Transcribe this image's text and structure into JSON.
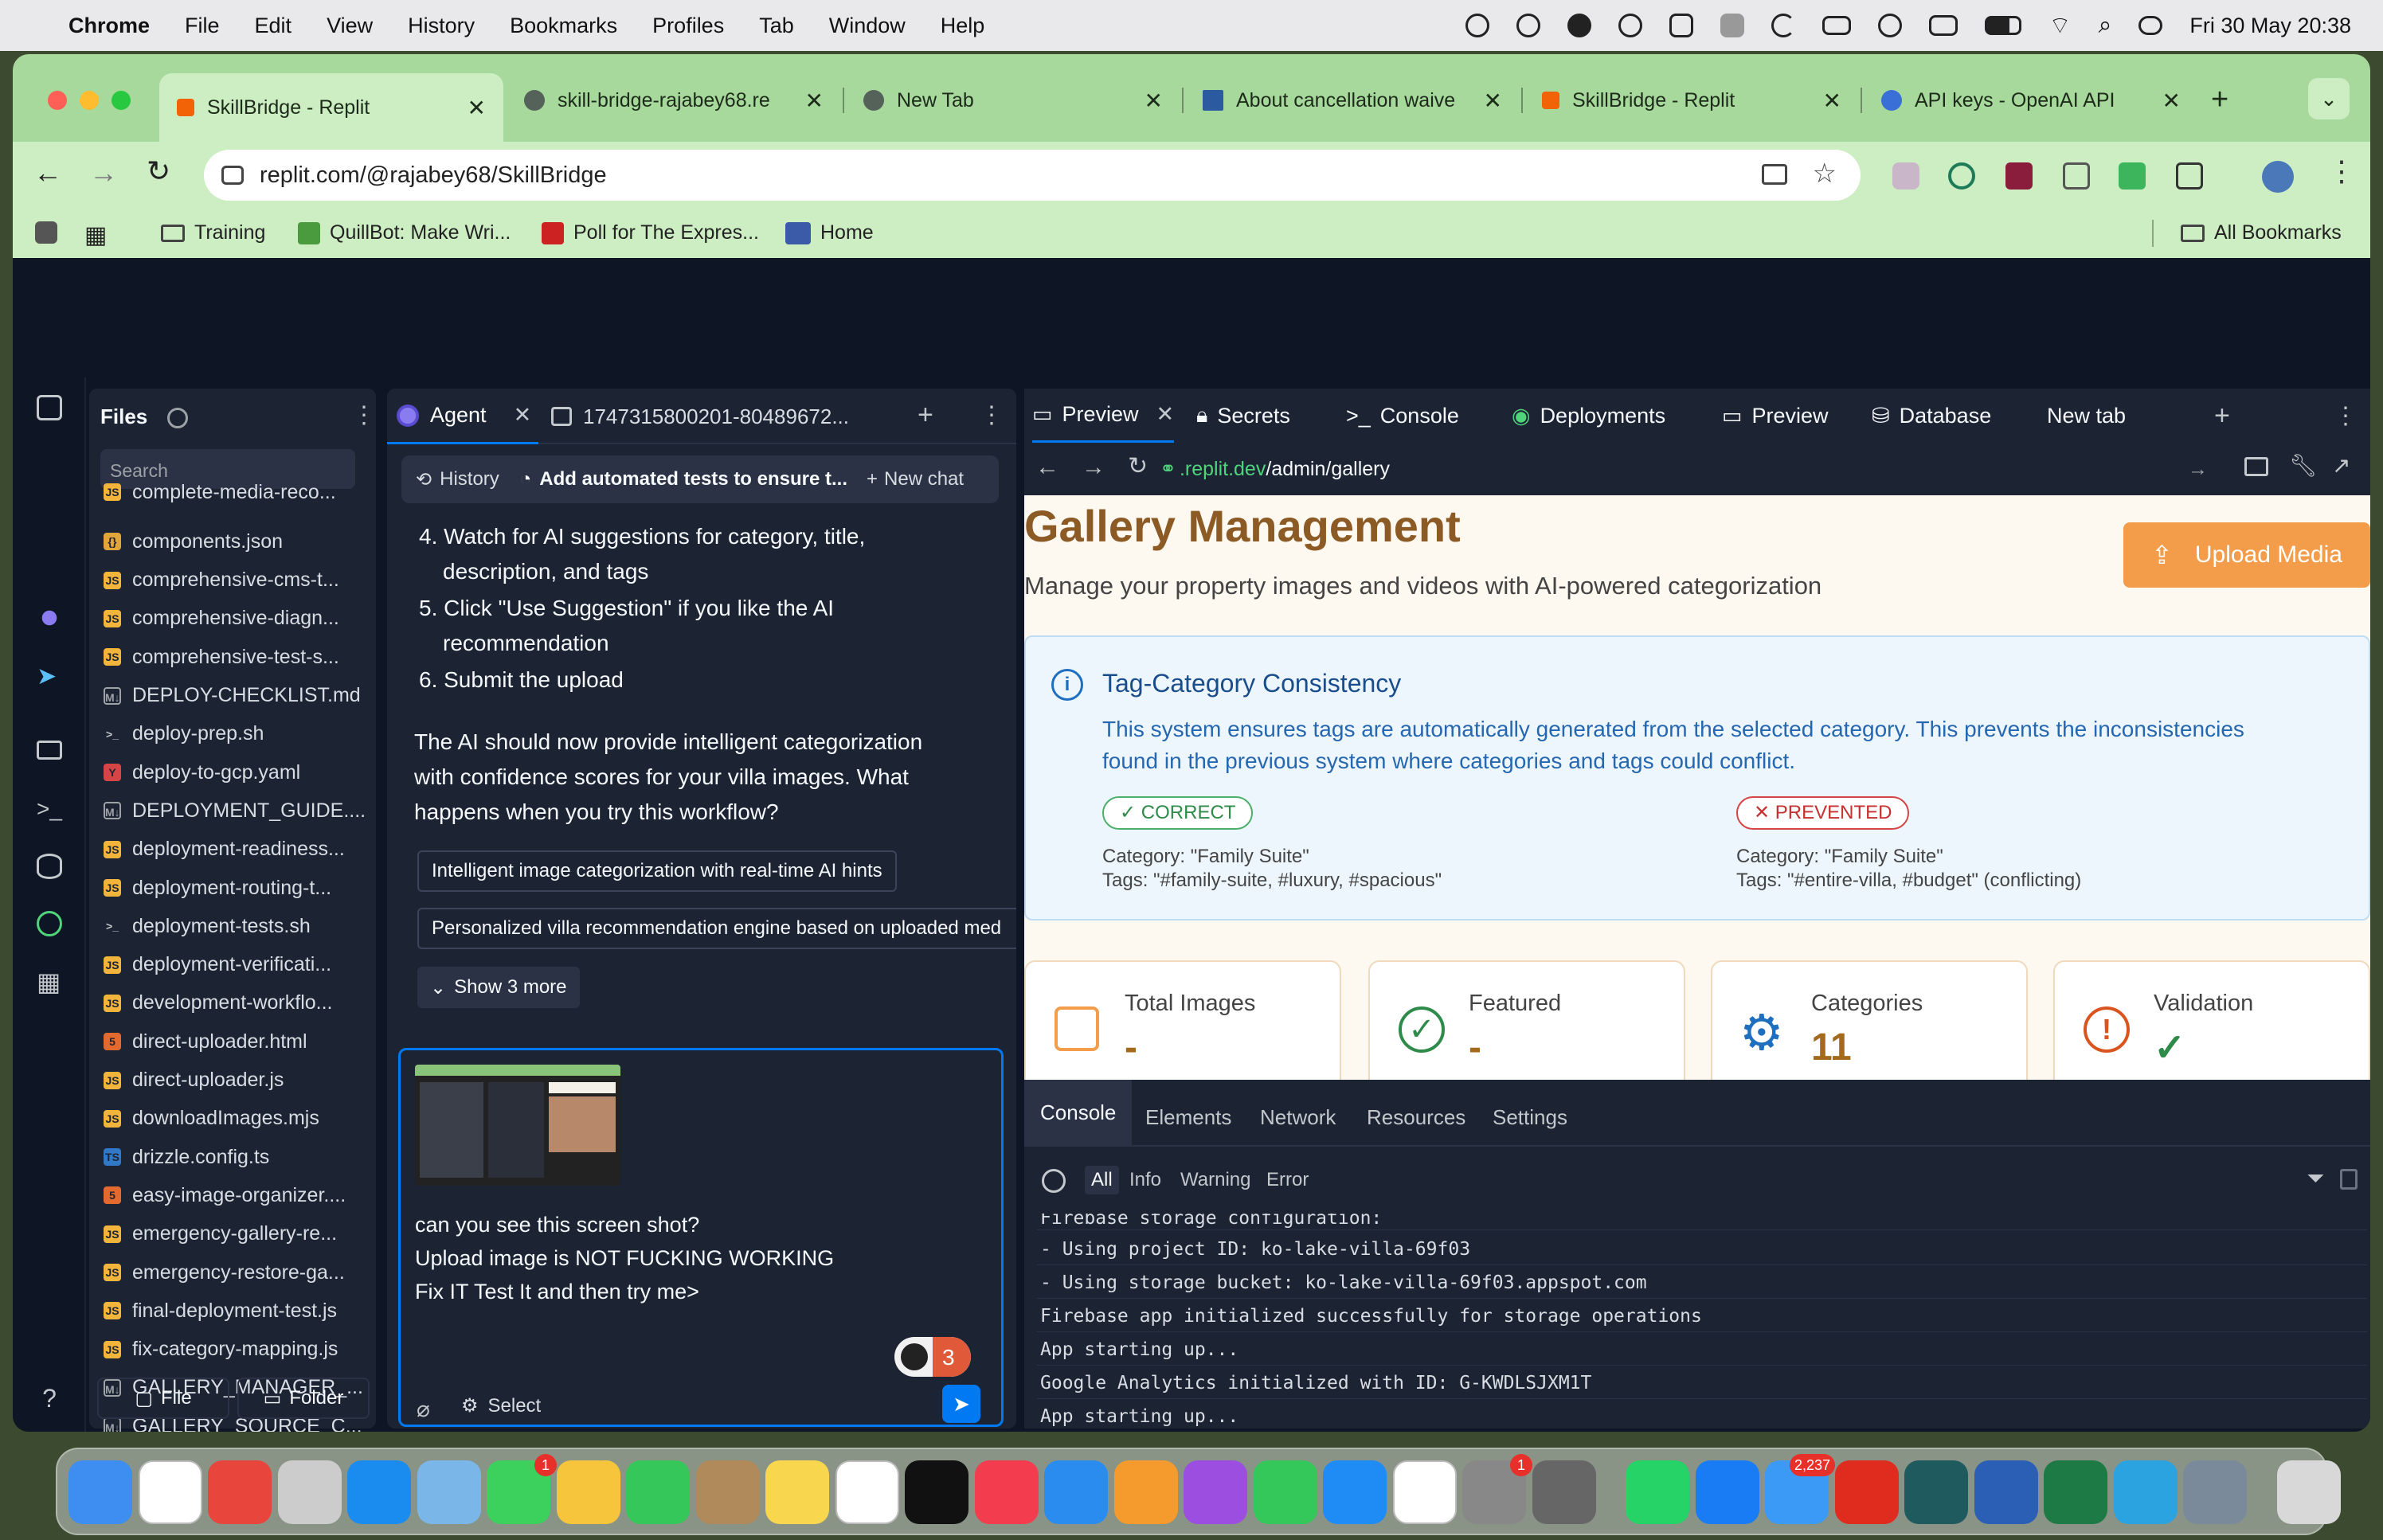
{
  "menubar": {
    "app": "Chrome",
    "items": [
      "File",
      "Edit",
      "View",
      "History",
      "Bookmarks",
      "Profiles",
      "Tab",
      "Window",
      "Help"
    ],
    "clock": "Fri 30 May  20:38"
  },
  "browser": {
    "tabs": [
      {
        "title": "SkillBridge - Replit",
        "active": true
      },
      {
        "title": "skill-bridge-rajabey68.re"
      },
      {
        "title": "New Tab"
      },
      {
        "title": "About cancellation waive"
      },
      {
        "title": "SkillBridge - Replit"
      },
      {
        "title": "API keys - OpenAI API"
      }
    ],
    "url": "replit.com/@rajabey68/SkillBridge",
    "bookmarks": [
      "Training",
      "QuillBot: Make Wri...",
      "Poll for The Expres...",
      "Home"
    ],
    "all_bookmarks": "All Bookmarks"
  },
  "files": {
    "title": "Files",
    "search_placeholder": "Search",
    "items": [
      {
        "name": "complete-media-reco...",
        "type": "js"
      },
      {
        "name": "components.json",
        "type": "json"
      },
      {
        "name": "comprehensive-cms-t...",
        "type": "js"
      },
      {
        "name": "comprehensive-diagn...",
        "type": "js"
      },
      {
        "name": "comprehensive-test-s...",
        "type": "js"
      },
      {
        "name": "DEPLOY-CHECKLIST.md",
        "type": "md"
      },
      {
        "name": "deploy-prep.sh",
        "type": "sh"
      },
      {
        "name": "deploy-to-gcp.yaml",
        "type": "yaml"
      },
      {
        "name": "DEPLOYMENT_GUIDE....",
        "type": "md"
      },
      {
        "name": "deployment-readiness...",
        "type": "js"
      },
      {
        "name": "deployment-routing-t...",
        "type": "js"
      },
      {
        "name": "deployment-tests.sh",
        "type": "sh"
      },
      {
        "name": "deployment-verificati...",
        "type": "js"
      },
      {
        "name": "development-workflo...",
        "type": "js"
      },
      {
        "name": "direct-uploader.html",
        "type": "html"
      },
      {
        "name": "direct-uploader.js",
        "type": "js"
      },
      {
        "name": "downloadImages.mjs",
        "type": "js"
      },
      {
        "name": "drizzle.config.ts",
        "type": "ts"
      },
      {
        "name": "easy-image-organizer....",
        "type": "html"
      },
      {
        "name": "emergency-gallery-re...",
        "type": "js"
      },
      {
        "name": "emergency-restore-ga...",
        "type": "js"
      },
      {
        "name": "final-deployment-test.js",
        "type": "js"
      },
      {
        "name": "fix-category-mapping.js",
        "type": "js"
      },
      {
        "name": "GALLERY_MANAGER_...",
        "type": "md"
      },
      {
        "name": "GALLERY_SOURCE_C...",
        "type": "md"
      }
    ],
    "btn_file": "File",
    "btn_folder": "Folder"
  },
  "agent": {
    "tab_agent": "Agent",
    "tab_file": "1747315800201-80489672...",
    "history": "History",
    "chat_title": "Add automated tests to ensure t...",
    "new_chat": "New chat",
    "steps": [
      "4. Watch for AI suggestions for category, title,",
      "description, and tags",
      "5. Click \"Use Suggestion\" if you like the AI",
      "recommendation",
      "6. Submit the upload"
    ],
    "message": [
      "The AI should now provide intelligent categorization",
      "with confidence scores for your villa images. What",
      "happens when you try this workflow?"
    ],
    "suggestions": [
      "Intelligent image categorization with real-time AI hints",
      "Personalized villa recommendation engine based on uploaded med"
    ],
    "show_more": "Show 3 more",
    "input_lines": [
      "can you see this screen shot?",
      "Upload image is NOT FUCKING WORKING",
      "Fix IT Test It and then try me>"
    ],
    "badge_count": "3",
    "select_label": "Select"
  },
  "preview": {
    "tabs": [
      "Preview",
      "Secrets",
      "Console",
      "Deployments",
      "Preview",
      "Database",
      "New tab"
    ],
    "url_host": ".replit.dev",
    "url_path": "/admin/gallery",
    "page": {
      "title": "Gallery Management",
      "subtitle": "Manage your property images and videos with AI-powered categorization",
      "upload_button": "Upload Media",
      "info_title": "Tag-Category Consistency",
      "info_text_1": "This system ensures tags are automatically generated from the selected category. This prevents the inconsistencies",
      "info_text_2": "found in the previous system where categories and tags could conflict.",
      "correct_badge": "✓ CORRECT",
      "correct_category": "Category: \"Family Suite\"",
      "correct_tags": "Tags: \"#family-suite, #luxury, #spacious\"",
      "prevented_badge": "✕ PREVENTED",
      "prevented_category": "Category: \"Family Suite\"",
      "prevented_tags": "Tags: \"#entire-villa, #budget\" (conflicting)",
      "stats": [
        {
          "label": "Total Images",
          "value": "-"
        },
        {
          "label": "Featured",
          "value": "-"
        },
        {
          "label": "Categories",
          "value": "11"
        },
        {
          "label": "Validation",
          "value": "✓"
        }
      ]
    },
    "devtools": {
      "tabs": [
        "Console",
        "Elements",
        "Network",
        "Resources",
        "Settings"
      ],
      "filters": [
        "All",
        "Info",
        "Warning",
        "Error"
      ],
      "logs": [
        "Firebase storage configuration:",
        "- Using project ID: ko-lake-villa-69f03",
        "- Using storage bucket: ko-lake-villa-69f03.appspot.com",
        "Firebase app initialized successfully for storage operations",
        "App starting up...",
        "Google Analytics initialized with ID: G-KWDLSJXM1T",
        "App starting up..."
      ]
    }
  },
  "dock": {
    "badges": {
      "messages": "1",
      "settings": "1",
      "mail": "2,237"
    },
    "apps": [
      "finder",
      "chatgpt",
      "chrome",
      "launchpad",
      "safari",
      "preview",
      "messages",
      "photos",
      "facetime",
      "contacts",
      "notes",
      "reminders",
      "tv",
      "news",
      "keynote",
      "pages",
      "podcasts",
      "numbers",
      "app-store",
      "freeform",
      "system-settings",
      "iphone-mirroring",
      "whatsapp",
      "messenger",
      "mail",
      "acrobat",
      "perplexity",
      "word",
      "excel",
      "telegram",
      "screenshot",
      "trash"
    ]
  },
  "colors": {
    "accent": "#0079f2",
    "orange": "#f39c4a",
    "brown": "#a36a1e",
    "tabgreen": "#a8d99c"
  }
}
